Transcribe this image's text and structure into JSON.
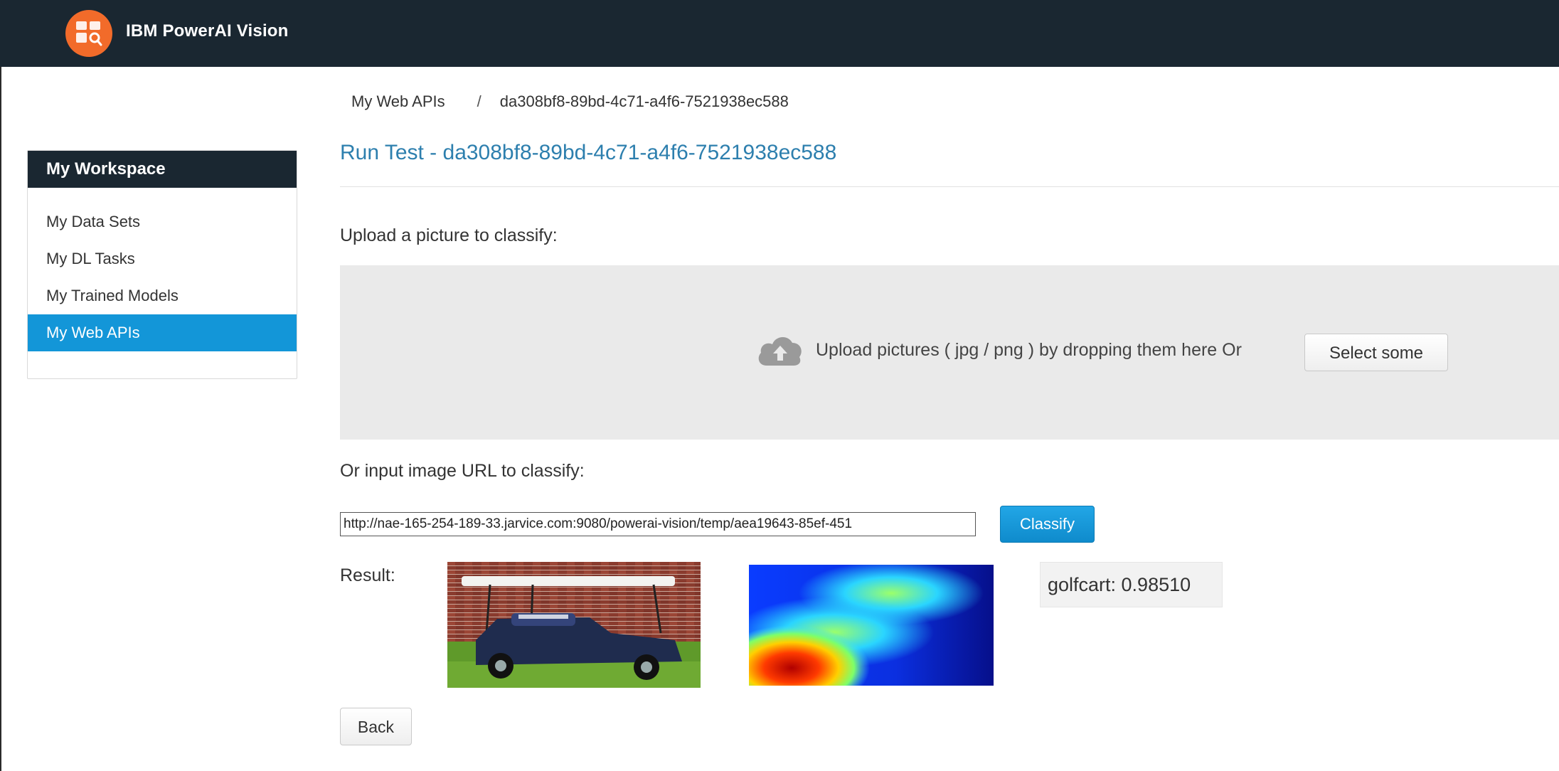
{
  "app": {
    "title": "IBM PowerAI Vision"
  },
  "sidebar": {
    "header": "My Workspace",
    "items": [
      {
        "label": "My Data Sets",
        "active": false
      },
      {
        "label": "My DL Tasks",
        "active": false
      },
      {
        "label": "My Trained Models",
        "active": false
      },
      {
        "label": "My Web APIs",
        "active": true
      }
    ]
  },
  "breadcrumb": {
    "root": "My Web APIs",
    "separator": "/",
    "current": "da308bf8-89bd-4c71-a4f6-7521938ec588"
  },
  "page": {
    "title": "Run Test - da308bf8-89bd-4c71-a4f6-7521938ec588"
  },
  "upload": {
    "label": "Upload a picture to classify:",
    "dropzone_text": "Upload pictures ( jpg / png ) by dropping them here Or",
    "select_button": "Select some",
    "icon": "cloud-upload-icon"
  },
  "url_input": {
    "label": "Or input image URL to classify:",
    "value": "http://nae-165-254-189-33.jarvice.com:9080/powerai-vision/temp/aea19643-85ef-451",
    "classify_button": "Classify"
  },
  "result": {
    "label": "Result:",
    "classification": "golfcart: 0.98510"
  },
  "actions": {
    "back_button": "Back"
  },
  "colors": {
    "header_bg": "#1a2731",
    "accent": "#1396d8",
    "logo": "#f26b2a",
    "title_blue": "#2d7fae"
  }
}
